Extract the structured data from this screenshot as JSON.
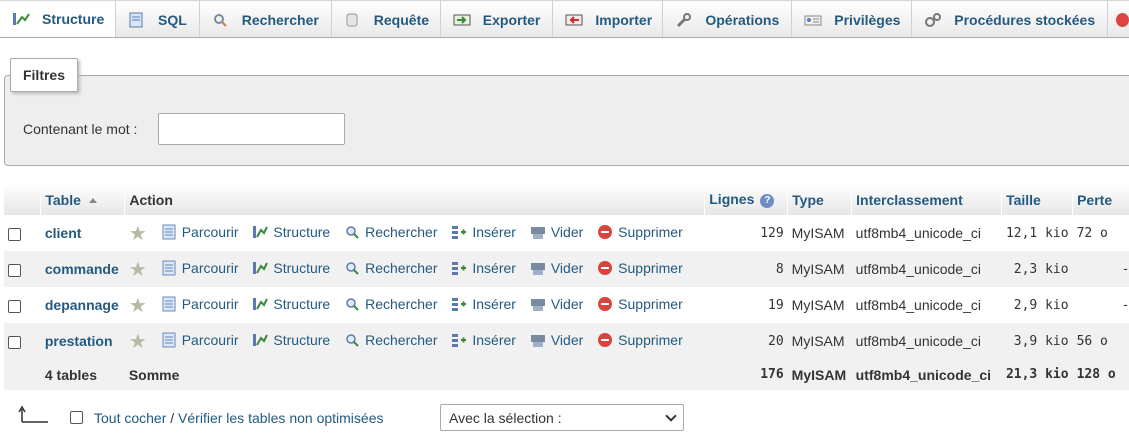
{
  "tabs": [
    {
      "label": "Structure",
      "icon": "structure-icon",
      "active": true
    },
    {
      "label": "SQL",
      "icon": "sql-icon"
    },
    {
      "label": "Rechercher",
      "icon": "search-icon"
    },
    {
      "label": "Requête",
      "icon": "query-icon"
    },
    {
      "label": "Exporter",
      "icon": "export-icon"
    },
    {
      "label": "Importer",
      "icon": "import-icon"
    },
    {
      "label": "Opérations",
      "icon": "wrench-icon"
    },
    {
      "label": "Privilèges",
      "icon": "privileges-icon"
    },
    {
      "label": "Procédures stockées",
      "icon": "routines-icon"
    }
  ],
  "filters": {
    "legend": "Filtres",
    "label": "Contenant le mot :",
    "value": ""
  },
  "table": {
    "headers": {
      "table": "Table",
      "action": "Action",
      "rows": "Lignes",
      "type": "Type",
      "collation": "Interclassement",
      "size": "Taille",
      "overhead": "Perte"
    },
    "actions": {
      "browse": "Parcourir",
      "structure": "Structure",
      "search": "Rechercher",
      "insert": "Insérer",
      "empty": "Vider",
      "drop": "Supprimer"
    },
    "rows": [
      {
        "name": "client",
        "rows": "129",
        "type": "MyISAM",
        "collation": "utf8mb4_unicode_ci",
        "size": "12,1 kio",
        "overhead": "72  o"
      },
      {
        "name": "commande",
        "rows": "8",
        "type": "MyISAM",
        "collation": "utf8mb4_unicode_ci",
        "size": "2,3 kio",
        "overhead": "-"
      },
      {
        "name": "depannage",
        "rows": "19",
        "type": "MyISAM",
        "collation": "utf8mb4_unicode_ci",
        "size": "2,9 kio",
        "overhead": "-"
      },
      {
        "name": "prestation",
        "rows": "20",
        "type": "MyISAM",
        "collation": "utf8mb4_unicode_ci",
        "size": "3,9 kio",
        "overhead": "56  o"
      }
    ],
    "footer": {
      "count": "4 tables",
      "label": "Somme",
      "rows": "176",
      "type": "MyISAM",
      "collation": "utf8mb4_unicode_ci",
      "size": "21,3 kio",
      "overhead": "128 o"
    }
  },
  "bulk": {
    "check_all": "Tout cocher",
    "separator": " / ",
    "check_unoptimized": "Vérifier les tables non optimisées",
    "with_selected": "Avec la sélection :"
  },
  "colors": {
    "link": "#235a81",
    "header_bg": "#e6e6e6",
    "even_row": "#f1f1f1"
  }
}
